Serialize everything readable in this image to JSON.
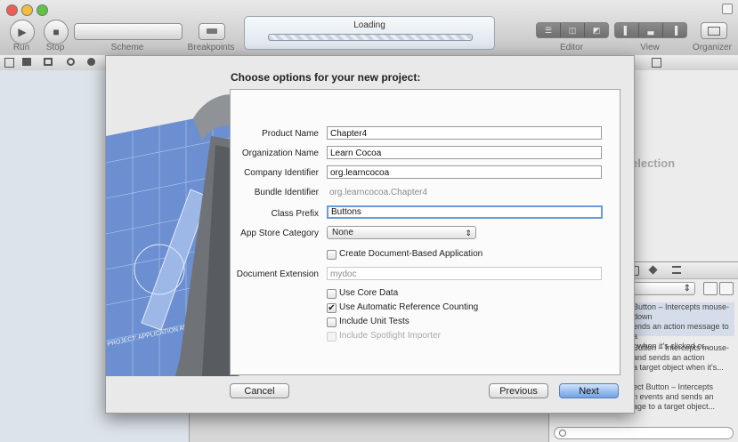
{
  "toolbar": {
    "run_label": "Run",
    "stop_label": "Stop",
    "scheme_label": "Scheme",
    "breakpoints_label": "Breakpoints",
    "activity_text": "Loading",
    "editor_label": "Editor",
    "view_label": "View",
    "organizer_label": "Organizer"
  },
  "dialog": {
    "title": "Choose options for your new project:",
    "fields": {
      "product_name": {
        "label": "Product Name",
        "value": "Chapter4"
      },
      "organization_name": {
        "label": "Organization Name",
        "value": "Learn Cocoa"
      },
      "company_identifier": {
        "label": "Company Identifier",
        "value": "org.learncocoa"
      },
      "bundle_identifier": {
        "label": "Bundle Identifier",
        "value": "org.learncocoa.Chapter4"
      },
      "class_prefix": {
        "label": "Class Prefix",
        "value": "Buttons"
      },
      "app_store_category": {
        "label": "App Store Category",
        "value": "None"
      },
      "document_extension": {
        "label": "Document Extension",
        "placeholder": "mydoc"
      }
    },
    "checkboxes": {
      "document_based": {
        "label": "Create Document-Based Application",
        "checked": false
      },
      "core_data": {
        "label": "Use Core Data",
        "checked": false
      },
      "arc": {
        "label": "Use Automatic Reference Counting",
        "checked": true
      },
      "unit_tests": {
        "label": "Include Unit Tests",
        "checked": false
      },
      "spotlight": {
        "label": "Include Spotlight Importer",
        "checked": false,
        "enabled": false
      }
    },
    "buttons": {
      "cancel": "Cancel",
      "previous": "Previous",
      "next": "Next"
    }
  },
  "right_pane": {
    "no_selection_fragment": "election",
    "library_items": [
      {
        "line1": "Button – Intercepts mouse-down",
        "line2": "ends an action message to a",
        "line3": "t when it's clicked or..."
      },
      {
        "line1": "Button – Intercepts mouse-",
        "line2": "and sends an action",
        "line3": "a target object when it's..."
      },
      {
        "line1": "ect Button – Intercepts",
        "line2": "n events and sends an",
        "line3": "age to a target object..."
      }
    ]
  },
  "blueprint_text": "PROJECT: APPLICATION APP"
}
